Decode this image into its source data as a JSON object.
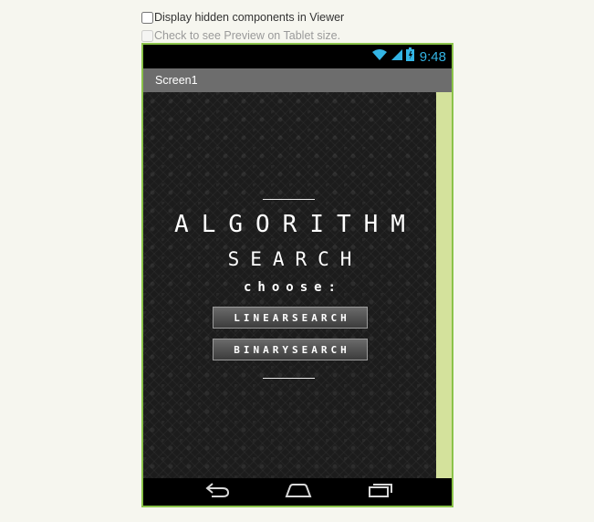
{
  "options": {
    "show_hidden_label": "Display hidden components in Viewer",
    "show_hidden_checked": false,
    "tablet_preview_label": "Check to see Preview on Tablet size.",
    "tablet_preview_checked": false
  },
  "status_bar": {
    "time": "9:48",
    "icons": [
      "wifi-icon",
      "signal-icon",
      "battery-icon"
    ]
  },
  "title_bar": {
    "title": "Screen1"
  },
  "app": {
    "heading1": "ALGORITHM",
    "heading2": "SEARCH",
    "prompt": "choose:",
    "buttons": {
      "linear": "LINEARSEARCH",
      "binary": "BINARYSEARCH"
    }
  },
  "nav_bar": {
    "icons": [
      "back-icon",
      "home-icon",
      "recent-apps-icon"
    ]
  },
  "colors": {
    "page_background": "#f6f6ef",
    "device_border": "#8bc34a",
    "status_accent": "#33b5e5",
    "title_bar": "#6d6d6d",
    "scroll_strip": "#d4e29c",
    "screen_background": "#1c1c1c"
  }
}
